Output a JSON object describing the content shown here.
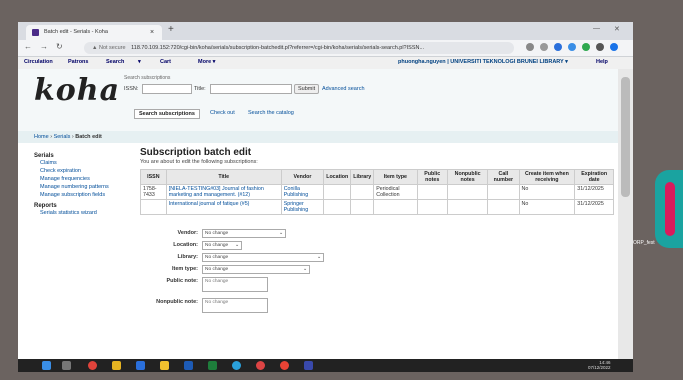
{
  "browser": {
    "tab_title": "Batch edit - Serials - Koha",
    "tab_close": "×",
    "new_tab": "+",
    "not_secure": "▲ Not secure",
    "url": "118.70.109.152:720/cgi-bin/koha/serials/subscription-batchedit.pl?referrer=/cgi-bin/koha/serials/serials-search.pl?ISSN..."
  },
  "koha_nav": {
    "items": [
      "Circulation",
      "Patrons",
      "Search",
      "▾",
      "Cart",
      "More ▾"
    ],
    "user": "phuongha.nguyen | UNIVERSITI TEKNOLOGI BRUNEI LIBRARY ▾",
    "help": "Help"
  },
  "header": {
    "logo": "koha",
    "search_label": "Search subscriptions",
    "issn_label": "ISSN:",
    "title_label": "Title:",
    "submit": "Submit",
    "advanced": "Advanced search",
    "tabs": [
      "Search subscriptions",
      "Check out",
      "Search the catalog"
    ]
  },
  "breadcrumb": {
    "home": "Home",
    "serials": "Serials",
    "current": "Batch edit",
    "sep": " › "
  },
  "sidebar": {
    "serials_heading": "Serials",
    "items": [
      "Claims",
      "Check expiration",
      "Manage frequencies",
      "Manage numbering patterns",
      "Manage subscription fields"
    ],
    "reports_heading": "Reports",
    "report_items": [
      "Serials statistics wizard"
    ]
  },
  "main": {
    "title": "Subscription batch edit",
    "subtitle": "You are about to edit the following subscriptions:",
    "columns": [
      "ISSN",
      "Title",
      "Vendor",
      "Location",
      "Library",
      "Item type",
      "Public notes",
      "Nonpublic notes",
      "Call number",
      "Create item when receiving",
      "Expiration date"
    ],
    "rows": [
      [
        "1758-7433",
        "[NIELA-TESTING#03] Journal of fashion marketing and management. (#12)",
        "Conilla Publishing",
        "",
        "",
        "Periodical Collection",
        "",
        "",
        "",
        "No",
        "31/12/2025"
      ],
      [
        "",
        "International journal of fatique (#5)",
        "Springer Publishing",
        "",
        "",
        "",
        "",
        "",
        "",
        "No",
        "31/12/2025"
      ]
    ]
  },
  "form": {
    "vendor_label": "Vendor:",
    "vendor_value": "No change",
    "location_label": "Location:",
    "location_value": "No change",
    "library_label": "Library:",
    "library_value": "No change",
    "itemtype_label": "Item type:",
    "itemtype_value": "No change",
    "public_note_label": "Public note:",
    "public_note_placeholder": "No change",
    "nonpublic_note_label": "Nonpublic note:",
    "nonpublic_note_placeholder": "No change"
  },
  "taskbar": {
    "time": "14:46",
    "date": "07/12/2022"
  },
  "overlay": {
    "side_label": "DLCORP_fest"
  }
}
